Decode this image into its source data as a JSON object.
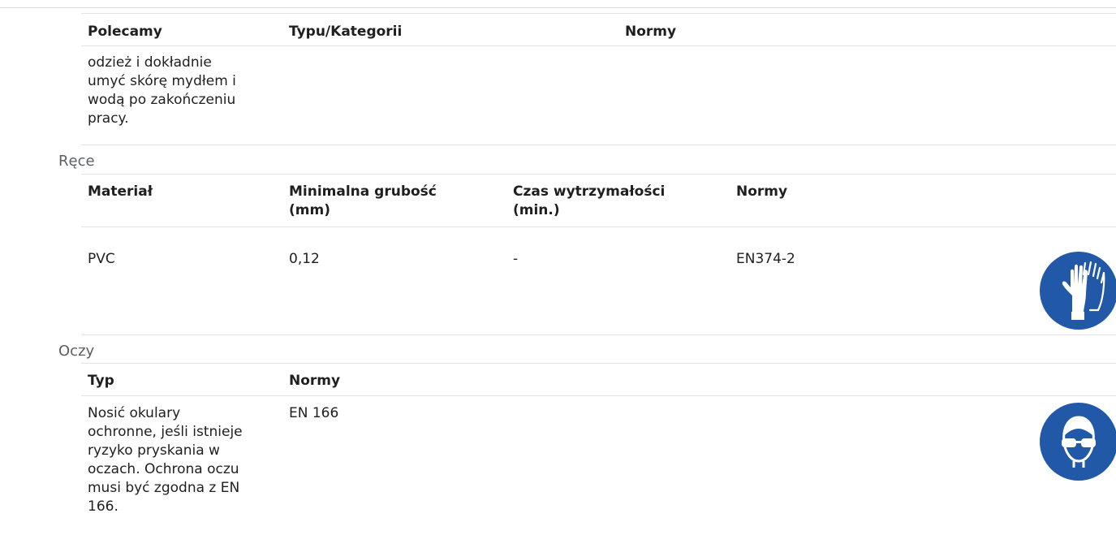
{
  "table1": {
    "headers": [
      "Polecamy",
      "Typu/Kategorii",
      "Normy"
    ],
    "row_text_lines": [
      "odzież i dokładnie",
      "umyć skórę mydłem i",
      "wodą po zakończeniu",
      "pracy."
    ]
  },
  "hands": {
    "section_title": "Ręce",
    "headers": [
      "Materiał",
      "Minimalna grubość (mm)",
      "Czas wytrzymałości (min.)",
      "Normy"
    ],
    "row": [
      "PVC",
      "0,12",
      "-",
      "EN374-2"
    ],
    "icon": "gloves-icon",
    "icon_color": "#2158a8"
  },
  "eyes": {
    "section_title": "Oczy",
    "headers": [
      "Typ",
      "Normy"
    ],
    "row_text_lines": [
      "Nosić okulary",
      "ochronne, jeśli istnieje",
      "ryzyko pryskania w",
      "oczach. Ochrona oczu",
      "musi być zgodna z EN",
      "166."
    ],
    "row_norm": "EN 166",
    "icon": "safety-goggles-icon",
    "icon_color": "#2158a8"
  }
}
